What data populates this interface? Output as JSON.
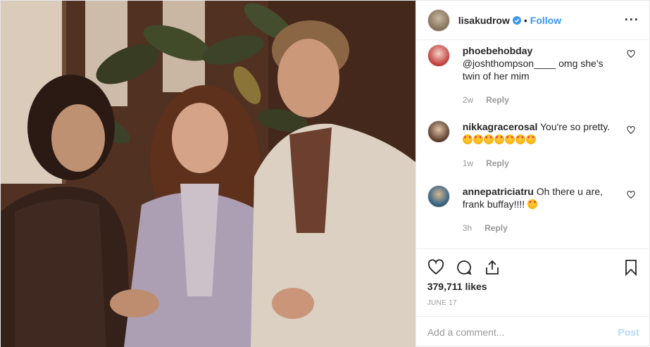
{
  "header": {
    "username": "lisakudrow",
    "separator": "•",
    "follow_label": "Follow",
    "more_label": "···"
  },
  "comments": [
    {
      "username": "phoebehobday",
      "text": "@joshthompson____ omg she's twin of her mim",
      "age": "2w",
      "reply_label": "Reply"
    },
    {
      "username": "nikkagracerosal",
      "text": "You're so pretty.",
      "emoji_count": 7,
      "age": "1w",
      "reply_label": "Reply"
    },
    {
      "username": "annepatriciatru",
      "text": "Oh there u are, frank buffay!!!!",
      "age": "3h",
      "reply_label": "Reply"
    }
  ],
  "stats": {
    "likes": "379,711 likes",
    "date": "JUNE 17"
  },
  "composer": {
    "placeholder": "Add a comment...",
    "post_label": "Post"
  },
  "colors": {
    "link_blue": "#3897f0",
    "post_disabled": "#b3dbff",
    "meta_gray": "#999999"
  }
}
